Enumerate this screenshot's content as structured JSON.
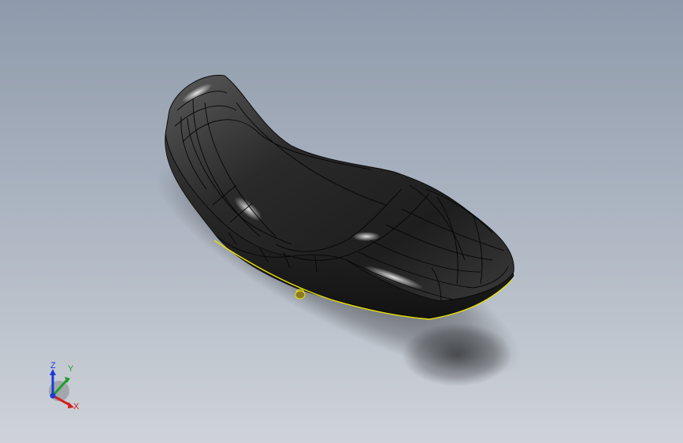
{
  "viewport": {
    "background_top": "#8e9aab",
    "background_bottom": "#cfd3d9"
  },
  "model": {
    "name": "motorcycle-seat",
    "shading": "shaded-with-edges",
    "body_color": "#2b2b2b",
    "edge_color": "#0a0a0a",
    "base_outline_color": "#e6e000"
  },
  "triad": {
    "z_label": "Z",
    "y_label": "Y",
    "x_label": "X",
    "z_color": "#1a3ad8",
    "y_color": "#1f9e2c",
    "x_color": "#d21f1f"
  }
}
